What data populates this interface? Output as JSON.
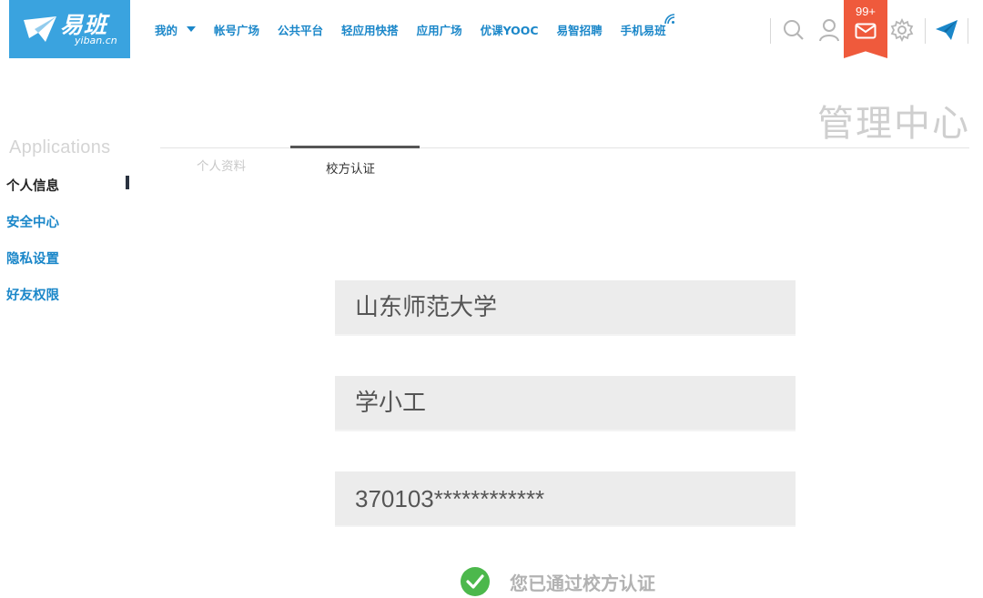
{
  "brand": {
    "name_cn": "易班",
    "domain": "yiban.cn",
    "color": "#3aa3df"
  },
  "topnav": {
    "items": [
      {
        "label": "我的",
        "has_dropdown": true
      },
      {
        "label": "帐号广场"
      },
      {
        "label": "公共平台"
      },
      {
        "label": "轻应用快搭"
      },
      {
        "label": "应用广场"
      },
      {
        "label": "优课YOOC"
      },
      {
        "label": "易智招聘"
      },
      {
        "label": "手机易班"
      }
    ],
    "link_color": "#1b87c9"
  },
  "toolbar": {
    "icons": [
      "search-icon",
      "user-icon",
      "mail-icon",
      "gear-icon",
      "send-icon"
    ],
    "mail_badge": "99+",
    "mail_badge_color": "#ef5a3c"
  },
  "page": {
    "title": "管理中心"
  },
  "sidebar": {
    "title": "Applications",
    "items": [
      {
        "label": "个人信息",
        "active": true
      },
      {
        "label": "安全中心"
      },
      {
        "label": "隐私设置"
      },
      {
        "label": "好友权限"
      }
    ]
  },
  "tabs": [
    {
      "label": "个人资料",
      "active": false
    },
    {
      "label": "校方认证",
      "active": true
    }
  ],
  "form": {
    "school": "山东师范大学",
    "name": "学小工",
    "id_number": "370103************"
  },
  "status": {
    "verified_text": "您已通过校方认证",
    "verified_color": "#4cb84c"
  }
}
